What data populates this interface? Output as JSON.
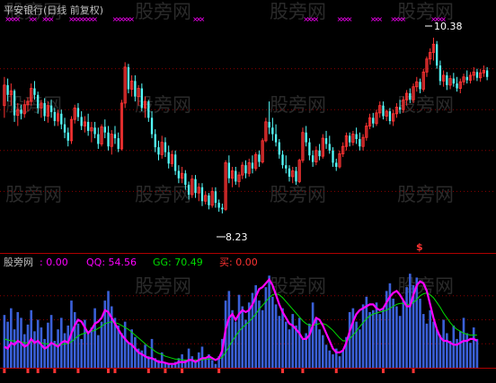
{
  "title": "平安银行(日线 前复权)",
  "watermark": "股旁网",
  "colors": {
    "background": "#000000",
    "up_candle": "#ff3333",
    "down_candle": "#54fcfc",
    "title": "#c0c0c0",
    "marker": "#ff00ff",
    "divider": "#b00000",
    "grid": "#8b0000",
    "hist": "#3a60d8",
    "qq_line": "#ff00ff",
    "gg_line": "#00dd00",
    "label_text": "#ffffff"
  },
  "top_labels": {
    "high": "10.38",
    "low": "8.23",
    "signal": "$"
  },
  "indicator_legend": {
    "name": "股旁网",
    "name_value": "0.00",
    "qq_label": "QQ:",
    "qq_value": "54.56",
    "gg_label": "GG:",
    "gg_value": "70.49",
    "buy_label": "买:",
    "buy_value": "0.00"
  },
  "chart_data": [
    {
      "type": "candlestick",
      "title": "平安银行(日线 前复权)",
      "ylim": [
        7.9,
        10.6
      ],
      "gridlines": [
        10.0,
        9.5,
        9.0,
        8.5
      ],
      "annotations": [
        {
          "label": "10.38",
          "bar": 129
        },
        {
          "label": "8.23",
          "bar": 65
        }
      ],
      "ohlc": [
        [
          9.55,
          9.9,
          9.4,
          9.8
        ],
        [
          9.8,
          9.88,
          9.6,
          9.68
        ],
        [
          9.68,
          9.82,
          9.55,
          9.73
        ],
        [
          9.73,
          9.75,
          9.35,
          9.43
        ],
        [
          9.43,
          9.58,
          9.3,
          9.5
        ],
        [
          9.5,
          9.56,
          9.38,
          9.45
        ],
        [
          9.45,
          9.62,
          9.4,
          9.56
        ],
        [
          9.56,
          9.65,
          9.48,
          9.6
        ],
        [
          9.6,
          9.82,
          9.55,
          9.76
        ],
        [
          9.76,
          9.85,
          9.62,
          9.68
        ],
        [
          9.68,
          9.72,
          9.45,
          9.52
        ],
        [
          9.52,
          9.62,
          9.4,
          9.58
        ],
        [
          9.58,
          9.64,
          9.36,
          9.42
        ],
        [
          9.42,
          9.6,
          9.34,
          9.55
        ],
        [
          9.55,
          9.62,
          9.4,
          9.47
        ],
        [
          9.47,
          9.52,
          9.3,
          9.36
        ],
        [
          9.36,
          9.5,
          9.3,
          9.45
        ],
        [
          9.45,
          9.5,
          9.26,
          9.32
        ],
        [
          9.32,
          9.4,
          9.15,
          9.22
        ],
        [
          9.22,
          9.28,
          9.05,
          9.12
        ],
        [
          9.12,
          9.42,
          9.08,
          9.38
        ],
        [
          9.38,
          9.56,
          9.33,
          9.52
        ],
        [
          9.52,
          9.58,
          9.36,
          9.41
        ],
        [
          9.41,
          9.48,
          9.25,
          9.3
        ],
        [
          9.3,
          9.42,
          9.22,
          9.35
        ],
        [
          9.35,
          9.45,
          9.18,
          9.24
        ],
        [
          9.24,
          9.35,
          9.1,
          9.28
        ],
        [
          9.28,
          9.35,
          9.15,
          9.2
        ],
        [
          9.2,
          9.28,
          9.02,
          9.08
        ],
        [
          9.08,
          9.32,
          9.05,
          9.29
        ],
        [
          9.29,
          9.38,
          9.15,
          9.22
        ],
        [
          9.22,
          9.3,
          9.0,
          9.05
        ],
        [
          9.05,
          9.25,
          8.95,
          9.2
        ],
        [
          9.2,
          9.3,
          9.08,
          9.15
        ],
        [
          9.15,
          9.22,
          8.98,
          9.02
        ],
        [
          9.02,
          9.62,
          9.0,
          9.58
        ],
        [
          9.58,
          10.08,
          9.52,
          10.02
        ],
        [
          10.02,
          10.06,
          9.7,
          9.75
        ],
        [
          9.75,
          9.92,
          9.66,
          9.85
        ],
        [
          9.85,
          9.92,
          9.6,
          9.66
        ],
        [
          9.66,
          9.8,
          9.55,
          9.76
        ],
        [
          9.76,
          9.82,
          9.48,
          9.52
        ],
        [
          9.52,
          9.66,
          9.4,
          9.6
        ],
        [
          9.6,
          9.62,
          9.35,
          9.4
        ],
        [
          9.4,
          9.48,
          9.15,
          9.2
        ],
        [
          9.2,
          9.26,
          8.98,
          9.04
        ],
        [
          9.04,
          9.12,
          8.88,
          8.95
        ],
        [
          8.95,
          9.18,
          8.9,
          9.1
        ],
        [
          9.1,
          9.16,
          8.92,
          8.98
        ],
        [
          8.98,
          9.06,
          8.78,
          8.84
        ],
        [
          8.84,
          9.0,
          8.8,
          8.95
        ],
        [
          8.95,
          9.0,
          8.7,
          8.75
        ],
        [
          8.75,
          8.82,
          8.6,
          8.66
        ],
        [
          8.66,
          8.8,
          8.6,
          8.72
        ],
        [
          8.72,
          8.76,
          8.52,
          8.58
        ],
        [
          8.58,
          8.62,
          8.4,
          8.46
        ],
        [
          8.46,
          8.7,
          8.42,
          8.65
        ],
        [
          8.65,
          8.7,
          8.42,
          8.48
        ],
        [
          8.48,
          8.6,
          8.38,
          8.55
        ],
        [
          8.55,
          8.6,
          8.32,
          8.38
        ],
        [
          8.38,
          8.5,
          8.34,
          8.45
        ],
        [
          8.45,
          8.48,
          8.28,
          8.33
        ],
        [
          8.33,
          8.55,
          8.3,
          8.5
        ],
        [
          8.5,
          8.55,
          8.3,
          8.36
        ],
        [
          8.36,
          8.4,
          8.25,
          8.3
        ],
        [
          8.3,
          8.35,
          8.23,
          8.28
        ],
        [
          8.28,
          8.88,
          8.26,
          8.85
        ],
        [
          8.85,
          8.94,
          8.6,
          8.66
        ],
        [
          8.66,
          8.8,
          8.55,
          8.75
        ],
        [
          8.75,
          8.8,
          8.58,
          8.62
        ],
        [
          8.62,
          8.74,
          8.55,
          8.7
        ],
        [
          8.7,
          8.86,
          8.65,
          8.82
        ],
        [
          8.82,
          8.88,
          8.66,
          8.72
        ],
        [
          8.72,
          8.9,
          8.68,
          8.85
        ],
        [
          8.85,
          8.94,
          8.72,
          8.78
        ],
        [
          8.78,
          8.98,
          8.75,
          8.95
        ],
        [
          8.95,
          9.0,
          8.8,
          8.86
        ],
        [
          8.86,
          9.15,
          8.84,
          9.12
        ],
        [
          9.12,
          9.4,
          9.1,
          9.35
        ],
        [
          9.35,
          9.6,
          9.2,
          9.28
        ],
        [
          9.28,
          9.4,
          9.12,
          9.2
        ],
        [
          9.2,
          9.32,
          9.05,
          9.1
        ],
        [
          9.1,
          9.14,
          8.9,
          8.95
        ],
        [
          8.95,
          9.0,
          8.78,
          8.82
        ],
        [
          8.82,
          8.94,
          8.72,
          8.78
        ],
        [
          8.78,
          8.82,
          8.62,
          8.68
        ],
        [
          8.68,
          8.8,
          8.6,
          8.75
        ],
        [
          8.75,
          8.8,
          8.58,
          8.62
        ],
        [
          8.62,
          8.9,
          8.6,
          8.88
        ],
        [
          8.88,
          9.28,
          8.85,
          9.22
        ],
        [
          9.22,
          9.3,
          9.05,
          9.1
        ],
        [
          9.1,
          9.15,
          8.88,
          8.94
        ],
        [
          8.94,
          9.0,
          8.8,
          8.86
        ],
        [
          8.86,
          9.05,
          8.82,
          9.0
        ],
        [
          9.0,
          9.08,
          8.88,
          8.93
        ],
        [
          8.93,
          9.2,
          8.9,
          9.15
        ],
        [
          9.15,
          9.24,
          9.02,
          9.08
        ],
        [
          9.08,
          9.18,
          8.96,
          9.0
        ],
        [
          9.0,
          9.04,
          8.8,
          8.85
        ],
        [
          8.85,
          8.9,
          8.75,
          8.8
        ],
        [
          8.8,
          9.0,
          8.78,
          8.96
        ],
        [
          8.96,
          9.1,
          8.92,
          9.05
        ],
        [
          9.05,
          9.22,
          9.0,
          9.18
        ],
        [
          9.18,
          9.22,
          9.05,
          9.1
        ],
        [
          9.1,
          9.24,
          9.06,
          9.2
        ],
        [
          9.2,
          9.28,
          9.08,
          9.14
        ],
        [
          9.14,
          9.22,
          9.0,
          9.05
        ],
        [
          9.05,
          9.2,
          9.0,
          9.16
        ],
        [
          9.16,
          9.34,
          9.12,
          9.3
        ],
        [
          9.3,
          9.45,
          9.26,
          9.4
        ],
        [
          9.4,
          9.46,
          9.28,
          9.33
        ],
        [
          9.33,
          9.5,
          9.3,
          9.46
        ],
        [
          9.46,
          9.6,
          9.4,
          9.55
        ],
        [
          9.55,
          9.6,
          9.38,
          9.42
        ],
        [
          9.42,
          9.5,
          9.36,
          9.48
        ],
        [
          9.48,
          9.52,
          9.32,
          9.36
        ],
        [
          9.36,
          9.5,
          9.3,
          9.45
        ],
        [
          9.45,
          9.58,
          9.4,
          9.53
        ],
        [
          9.53,
          9.62,
          9.45,
          9.5
        ],
        [
          9.5,
          9.66,
          9.46,
          9.62
        ],
        [
          9.62,
          9.74,
          9.55,
          9.7
        ],
        [
          9.7,
          9.76,
          9.58,
          9.62
        ],
        [
          9.62,
          9.82,
          9.58,
          9.78
        ],
        [
          9.78,
          9.9,
          9.72,
          9.84
        ],
        [
          9.84,
          9.88,
          9.7,
          9.75
        ],
        [
          9.75,
          10.0,
          9.72,
          9.96
        ],
        [
          9.96,
          10.15,
          9.9,
          10.12
        ],
        [
          10.12,
          10.25,
          10.05,
          10.2
        ],
        [
          10.2,
          10.38,
          10.1,
          10.3
        ],
        [
          10.3,
          10.34,
          10.0,
          10.04
        ],
        [
          10.04,
          10.1,
          9.8,
          9.85
        ],
        [
          9.85,
          9.98,
          9.78,
          9.92
        ],
        [
          9.92,
          9.96,
          9.74,
          9.8
        ],
        [
          9.8,
          9.92,
          9.75,
          9.88
        ],
        [
          9.88,
          9.95,
          9.78,
          9.82
        ],
        [
          9.82,
          9.9,
          9.72,
          9.76
        ],
        [
          9.76,
          9.88,
          9.7,
          9.84
        ],
        [
          9.84,
          9.94,
          9.8,
          9.9
        ],
        [
          9.9,
          9.98,
          9.82,
          9.86
        ],
        [
          9.86,
          9.96,
          9.82,
          9.92
        ],
        [
          9.92,
          10.02,
          9.86,
          9.96
        ],
        [
          9.96,
          10.0,
          9.85,
          9.89
        ],
        [
          9.89,
          10.0,
          9.84,
          9.95
        ],
        [
          9.95,
          10.04,
          9.9,
          9.98
        ],
        [
          9.98,
          10.02,
          9.86,
          9.9
        ]
      ],
      "markers_x": [
        [
          1,
          4
        ],
        [
          8,
          9
        ],
        [
          12,
          14
        ],
        [
          20,
          23
        ],
        [
          24,
          27
        ],
        [
          33,
          38
        ],
        [
          57,
          59
        ],
        [
          90,
          93
        ],
        [
          100,
          103
        ],
        [
          110,
          112
        ],
        [
          116,
          119
        ],
        [
          128,
          131
        ]
      ],
      "signal_bar": 129
    },
    {
      "type": "bar+line",
      "ylim": [
        0,
        100
      ],
      "series": [
        {
          "name": "QQ",
          "last": 54.56
        },
        {
          "name": "GG",
          "last": 70.49
        }
      ],
      "histogram": [
        55,
        48,
        62,
        40,
        58,
        52,
        35,
        45,
        60,
        38,
        50,
        42,
        30,
        47,
        55,
        28,
        40,
        52,
        36,
        44,
        70,
        58,
        46,
        30,
        50,
        38,
        42,
        62,
        34,
        48,
        70,
        80,
        64,
        52,
        44,
        36,
        48,
        26,
        40,
        32,
        20,
        18,
        24,
        12,
        30,
        10,
        8,
        16,
        5,
        4,
        3,
        6,
        10,
        14,
        8,
        20,
        12,
        6,
        16,
        22,
        10,
        14,
        8,
        4,
        12,
        30,
        70,
        80,
        60,
        48,
        76,
        64,
        50,
        68,
        78,
        86,
        70,
        60,
        84,
        96,
        74,
        66,
        54,
        62,
        48,
        40,
        56,
        44,
        52,
        30,
        36,
        46,
        68,
        52,
        40,
        34,
        24,
        18,
        14,
        20,
        12,
        18,
        32,
        58,
        62,
        48,
        40,
        66,
        74,
        58,
        60,
        68,
        56,
        62,
        80,
        88,
        72,
        64,
        54,
        70,
        84,
        98,
        86,
        94,
        72,
        56,
        46,
        60,
        48,
        40,
        34,
        50,
        36,
        28,
        44,
        30,
        38,
        52,
        36,
        26,
        42,
        30
      ],
      "qq": [
        22,
        20,
        26,
        24,
        28,
        26,
        22,
        24,
        30,
        26,
        28,
        24,
        20,
        22,
        26,
        24,
        22,
        26,
        28,
        26,
        36,
        44,
        50,
        48,
        42,
        36,
        40,
        46,
        48,
        52,
        60,
        58,
        52,
        46,
        40,
        34,
        30,
        26,
        24,
        20,
        16,
        14,
        12,
        10,
        10,
        8,
        6,
        6,
        5,
        4,
        4,
        4,
        6,
        6,
        6,
        8,
        8,
        6,
        8,
        10,
        10,
        12,
        10,
        8,
        10,
        18,
        40,
        52,
        56,
        50,
        56,
        60,
        58,
        60,
        66,
        74,
        82,
        84,
        88,
        92,
        86,
        76,
        66,
        58,
        52,
        46,
        44,
        40,
        36,
        30,
        30,
        34,
        44,
        52,
        50,
        44,
        36,
        28,
        20,
        16,
        16,
        18,
        26,
        38,
        48,
        56,
        60,
        62,
        64,
        66,
        66,
        62,
        60,
        62,
        68,
        74,
        78,
        80,
        76,
        70,
        64,
        64,
        76,
        86,
        90,
        88,
        80,
        66,
        52,
        40,
        32,
        28,
        28,
        26,
        24,
        24,
        26,
        28,
        28,
        30,
        30,
        28
      ],
      "gg": [
        30,
        29,
        28,
        28,
        27,
        27,
        26,
        26,
        27,
        27,
        27,
        26,
        25,
        25,
        25,
        25,
        24,
        24,
        25,
        25,
        27,
        30,
        33,
        35,
        36,
        37,
        38,
        39,
        41,
        43,
        46,
        47,
        48,
        47,
        46,
        44,
        42,
        40,
        37,
        34,
        31,
        28,
        25,
        22,
        20,
        17,
        15,
        14,
        12,
        11,
        10,
        9,
        9,
        8,
        8,
        8,
        8,
        8,
        8,
        8,
        9,
        9,
        9,
        9,
        9,
        11,
        16,
        22,
        28,
        33,
        38,
        42,
        45,
        48,
        52,
        56,
        61,
        65,
        69,
        73,
        76,
        77,
        76,
        73,
        69,
        65,
        61,
        57,
        53,
        49,
        46,
        44,
        44,
        45,
        46,
        46,
        45,
        42,
        39,
        35,
        31,
        28,
        28,
        30,
        34,
        38,
        43,
        47,
        51,
        54,
        56,
        57,
        58,
        59,
        60,
        62,
        64,
        66,
        67,
        67,
        66,
        66,
        68,
        71,
        75,
        77,
        78,
        76,
        73,
        68,
        63,
        57,
        52,
        47,
        43,
        40,
        38,
        36,
        35,
        34,
        34,
        34
      ],
      "buy_markers": [
        0,
        7,
        10,
        15,
        22,
        31,
        33,
        43,
        48,
        53,
        64,
        83,
        89,
        99,
        113,
        122
      ]
    }
  ]
}
